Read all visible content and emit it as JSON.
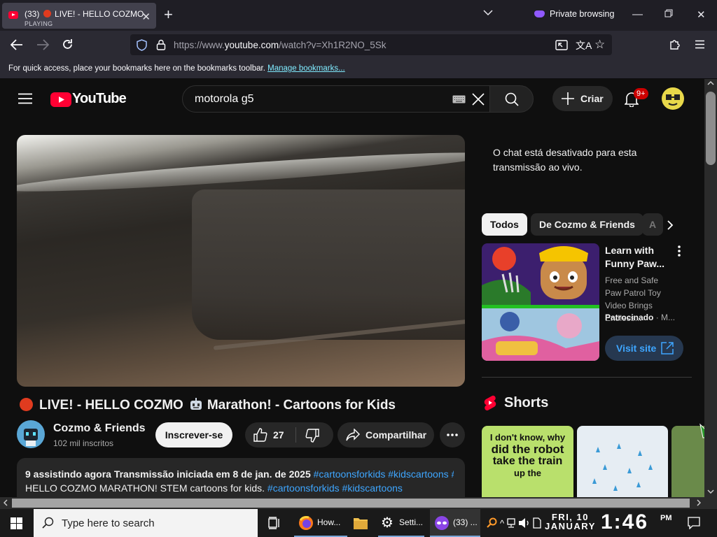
{
  "browser": {
    "tab": {
      "title_prefix": "(33)",
      "title": "LIVE! - HELLO COZMO",
      "status": "PLAYING"
    },
    "private_label": "Private browsing",
    "url": {
      "host_prefix": "https://www.",
      "host": "youtube.com",
      "path": "/watch?v=Xh1R2NO_5Sk"
    },
    "bookmarks": {
      "message": "For quick access, place your bookmarks here on the bookmarks toolbar.",
      "link": "Manage bookmarks..."
    }
  },
  "youtube": {
    "logo_text": "YouTube",
    "search_query": "motorola g5",
    "create_label": "Criar",
    "notification_count": "9+",
    "video": {
      "title_a": "LIVE! - HELLO COZMO",
      "title_b": "Marathon! - Cartoons for Kids",
      "channel": "Cozmo & Friends",
      "subscribers": "102 mil inscritos",
      "subscribe_label": "Inscrever-se",
      "likes": "27",
      "share_label": "Compartilhar",
      "desc_stats": "9 assistindo agora  Transmissão iniciada em 8 de jan. de 2025",
      "desc_tag1": "#cartoonsforkids",
      "desc_tag2": "#kidscartoons",
      "desc_tag3": "#",
      "desc_line2": "HELLO COZMO MARATHON! STEM cartoons for kids.",
      "desc_line2_tag1": "#cartoonsforkids",
      "desc_line2_tag2": "#kidscartoons"
    },
    "chat_disabled": "O chat está desativado para esta transmissão ao vivo.",
    "chips": [
      "Todos",
      "De Cozmo & Friends",
      "A"
    ],
    "ad": {
      "title": "Learn with Funny Paw...",
      "desc": "Free and Safe Paw Patrol Toy Video Brings Endless...",
      "sponsored": "Patrocinado",
      "advertiser": "M...",
      "visit_label": "Visit site"
    },
    "shorts_title": "Shorts",
    "short1_text": [
      "I don't know, why",
      "did the robot",
      "take the train",
      "up the"
    ]
  },
  "taskbar": {
    "search_placeholder": "Type here to search",
    "apps": [
      "How...",
      "Setti...",
      "(33) ..."
    ],
    "day": "FRI, 10",
    "month": "JANUARY",
    "time": "1:46",
    "ampm": "PM"
  }
}
